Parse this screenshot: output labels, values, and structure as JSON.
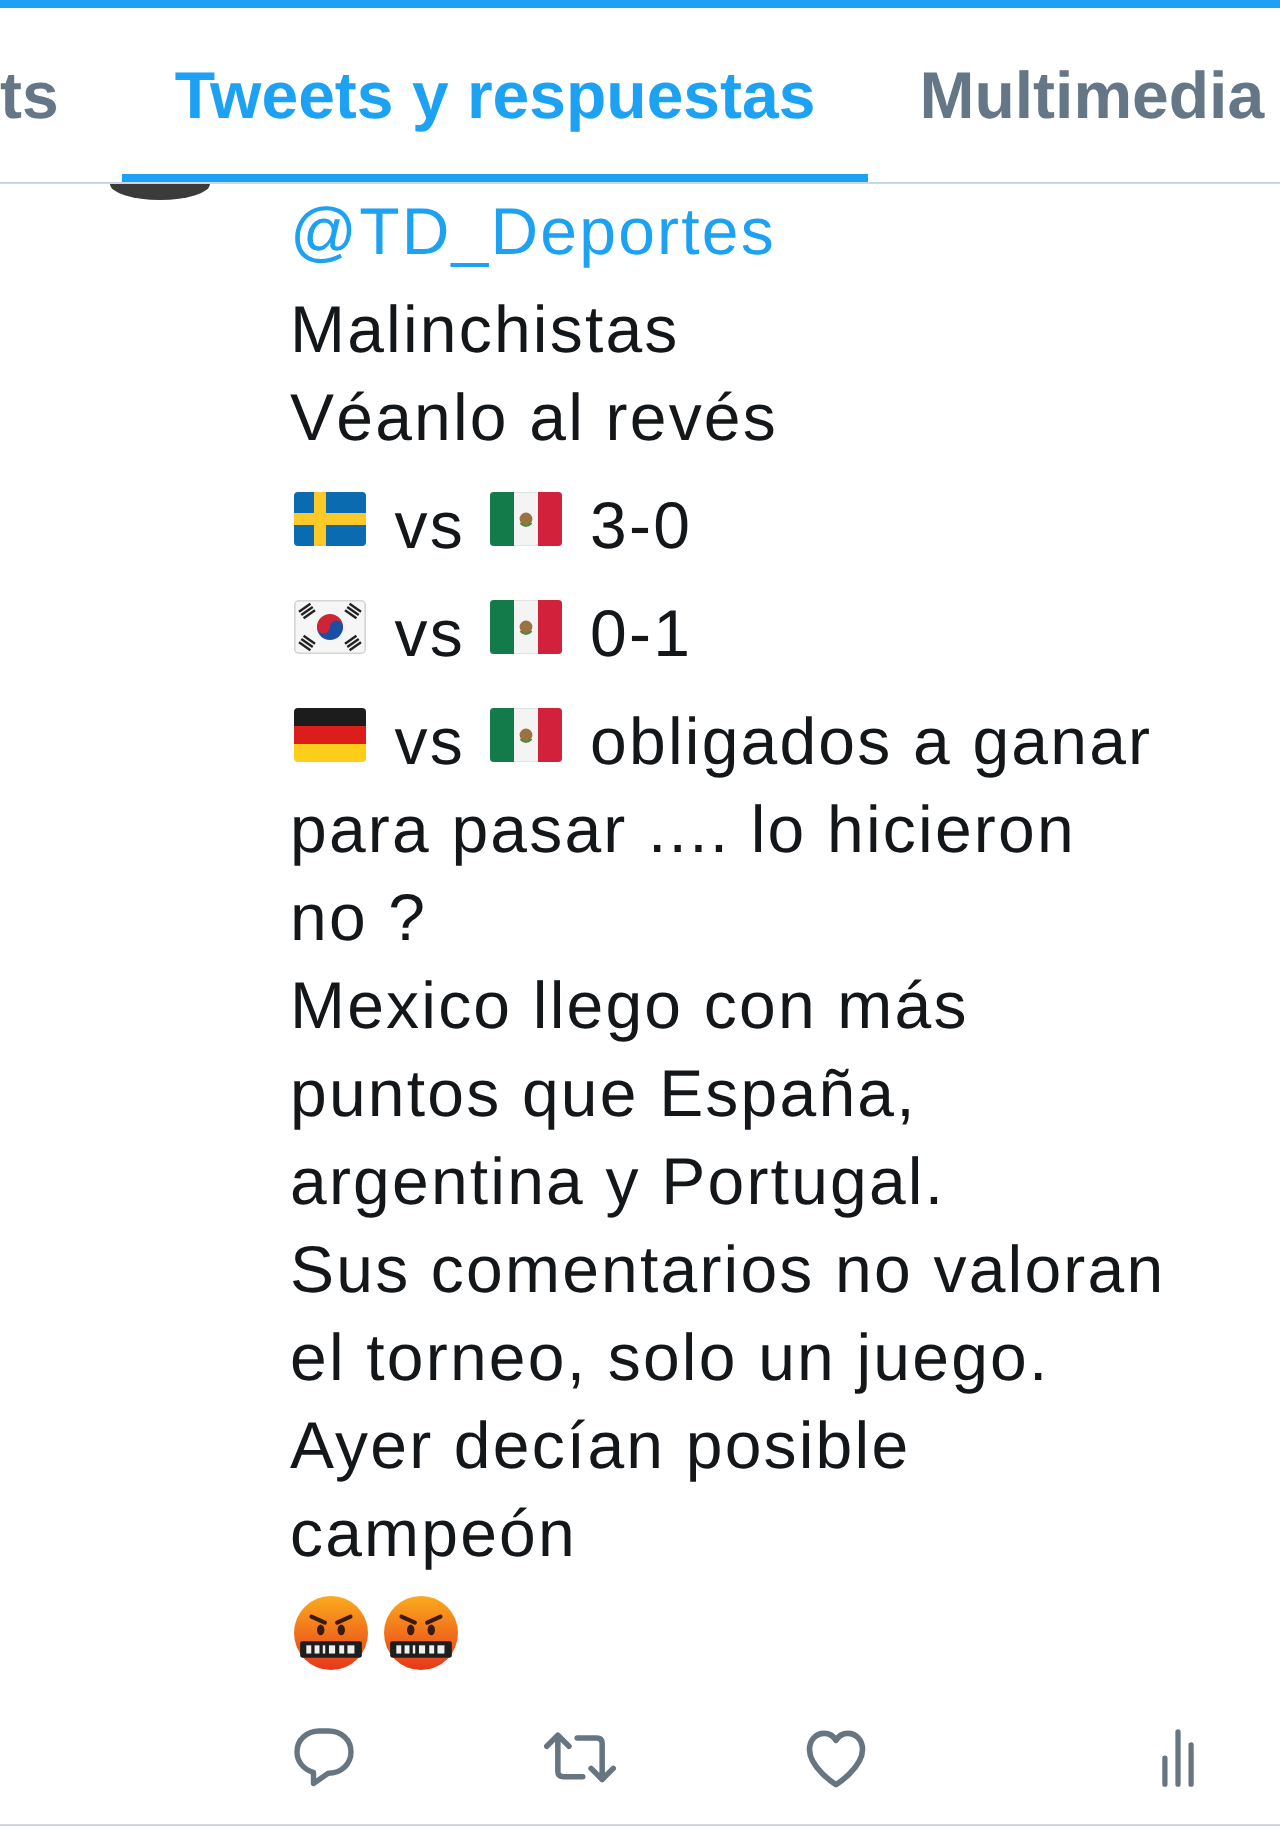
{
  "tabs": [
    {
      "label": "ts",
      "selected": false
    },
    {
      "label": "Tweets y respuestas",
      "selected": true
    },
    {
      "label": "Multimedia",
      "selected": false
    }
  ],
  "tweet": {
    "mention": "@TD_Deportes",
    "paragraphs": [
      {
        "parts": [
          {
            "kind": "text",
            "text": "Malinchistas"
          }
        ]
      },
      {
        "parts": [
          {
            "kind": "text",
            "text": "Véanlo al revés"
          }
        ]
      },
      {
        "parts": [
          {
            "kind": "sweden"
          },
          {
            "kind": "text",
            "text": "vs"
          },
          {
            "kind": "mexico"
          },
          {
            "kind": "text",
            "text": "3-0"
          }
        ]
      },
      {
        "parts": [
          {
            "kind": "korea"
          },
          {
            "kind": "text",
            "text": "vs"
          },
          {
            "kind": "mexico"
          },
          {
            "kind": "text",
            "text": "0-1"
          }
        ]
      },
      {
        "parts": [
          {
            "kind": "germany"
          },
          {
            "kind": "text",
            "text": "vs"
          },
          {
            "kind": "mexico"
          },
          {
            "kind": "text",
            "text": "obligados a ganar"
          }
        ]
      },
      {
        "parts": [
          {
            "kind": "text",
            "text": "para pasar .... lo hicieron no ?"
          }
        ]
      },
      {
        "parts": [
          {
            "kind": "text",
            "text": "Mexico llego con más puntos que España, argentina y Portugal."
          }
        ]
      },
      {
        "parts": [
          {
            "kind": "text",
            "text": "Sus comentarios no valoran el torneo, solo un juego."
          }
        ]
      },
      {
        "parts": [
          {
            "kind": "text",
            "text": "Ayer decían posible campeón"
          }
        ]
      },
      {
        "parts": [
          {
            "kind": "angry"
          },
          {
            "kind": "angry"
          }
        ]
      }
    ]
  }
}
